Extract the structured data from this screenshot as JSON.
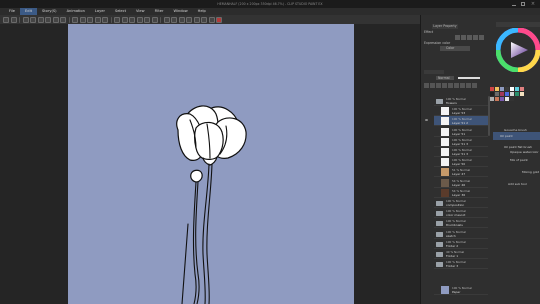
{
  "window": {
    "title": "HEMANHALF (200 x 200px 350dpi 46.7%) - CLIP STUDIO PAINT EX"
  },
  "menu": {
    "items": [
      "File",
      "Edit",
      "Story(S)",
      "Animation",
      "Layer",
      "Select",
      "View",
      "Filter",
      "Window",
      "Help"
    ],
    "active_index": 1
  },
  "right_panel": {
    "effect_label": "Effect",
    "layer_property_label": "Layer Property",
    "expression_color_label": "Expression color",
    "expression_color_value": "Color",
    "blend_mode": "Normal",
    "layers": [
      {
        "l1": "100 % Normal",
        "l2": "Layer 53",
        "thumb": "white",
        "selected": false
      },
      {
        "l1": "100 % Normal",
        "l2": "Layer 51 2",
        "thumb": "white",
        "selected": true
      },
      {
        "l1": "100 % Normal",
        "l2": "Layer 51",
        "thumb": "white",
        "selected": false
      },
      {
        "l1": "100 % Normal",
        "l2": "Layer 51 3",
        "thumb": "white",
        "selected": false
      },
      {
        "l1": "100 % Normal",
        "l2": "Layer 51 3",
        "thumb": "white",
        "selected": false
      },
      {
        "l1": "100 % Normal",
        "l2": "Layer 50",
        "thumb": "white",
        "selected": false
      },
      {
        "l1": "51 % Normal",
        "l2": "Layer 47",
        "thumb": "img",
        "selected": false
      },
      {
        "l1": "54 % Normal",
        "l2": "Layer 46",
        "thumb": "img2",
        "selected": false
      },
      {
        "l1": "54 % Normal",
        "l2": "Layer 36",
        "thumb": "img3",
        "selected": false
      },
      {
        "l1": "100 % Normal",
        "l2": "composition",
        "thumb": "folder",
        "selected": false
      },
      {
        "l1": "100 % Normal",
        "l2": "color mascot",
        "thumb": "folder",
        "selected": false
      },
      {
        "l1": "100 % Normal",
        "l2": "thumbnails",
        "thumb": "folder",
        "selected": false
      },
      {
        "l1": "100 % Normal",
        "l2": "sketch",
        "thumb": "folder",
        "selected": false
      },
      {
        "l1": "100 % Normal",
        "l2": "Folder 2",
        "thumb": "folder",
        "selected": false
      },
      {
        "l1": "40 % Normal",
        "l2": "Folder 1",
        "thumb": "folder",
        "selected": false
      },
      {
        "l1": "100 % Normal",
        "l2": "Folder 3",
        "thumb": "folder",
        "selected": false
      },
      {
        "l1": "100 % Normal",
        "l2": "Paper",
        "thumb": "blue",
        "selected": false
      }
    ],
    "top_layer": {
      "l1": "100 % Normal",
      "l2": "Layer 41",
      "folder_l1": "100 % Normal",
      "folder_l2": "flowers"
    },
    "subtools": [
      {
        "label": "Gouache brush",
        "selected": false
      },
      {
        "label": "Oil paint",
        "selected": true
      },
      {
        "label": "Oil paint flat brush",
        "selected": false
      },
      {
        "label": "Opaque watercolor",
        "selected": false
      },
      {
        "label": "Mix of paint",
        "selected": false
      },
      {
        "label": "Mixing gold",
        "selected": false
      },
      {
        "label": "Add sub tool",
        "selected": false
      }
    ]
  },
  "colors": {
    "canvas": "#8f9bc1",
    "selection": "#3e5478"
  }
}
